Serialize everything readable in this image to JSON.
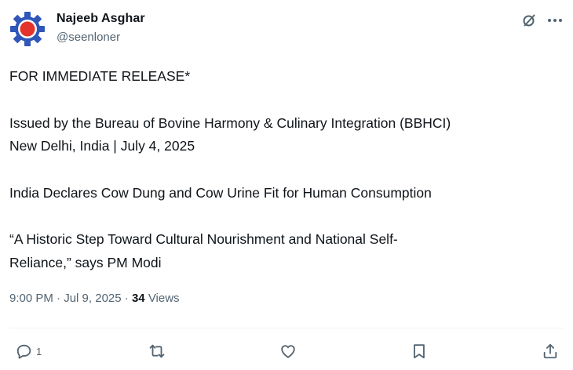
{
  "author": {
    "name": "Najeeb Asghar",
    "handle": "@seenloner",
    "avatar_icon": "gear-logo-icon",
    "avatar_colors": {
      "gear": "#2f56b8",
      "center": "#e4332b"
    }
  },
  "header_icons": [
    "grok-icon",
    "more-icon"
  ],
  "tweet": {
    "paragraphs": [
      [
        "FOR IMMEDIATE RELEASE*"
      ],
      [
        "Issued by the Bureau of Bovine Harmony & Culinary Integration (BBHCI)",
        "New Delhi, India | July 4, 2025"
      ],
      [
        "India Declares Cow Dung and Cow Urine Fit for Human Consumption"
      ],
      [
        "“A Historic Step Toward Cultural Nourishment and National Self-",
        "Reliance,” says PM Modi"
      ]
    ]
  },
  "meta": {
    "time": "9:00 PM",
    "separator": "·",
    "date": "Jul 9, 2025",
    "views_count": "34",
    "views_label": "Views"
  },
  "actions": {
    "reply": {
      "icon": "reply-icon",
      "count": "1"
    },
    "repost": {
      "icon": "repost-icon"
    },
    "like": {
      "icon": "like-icon"
    },
    "bookmark": {
      "icon": "bookmark-icon"
    },
    "share": {
      "icon": "share-icon"
    }
  },
  "colors": {
    "text_primary": "#0f1419",
    "text_secondary": "#536471",
    "divider": "#eff3f4"
  }
}
